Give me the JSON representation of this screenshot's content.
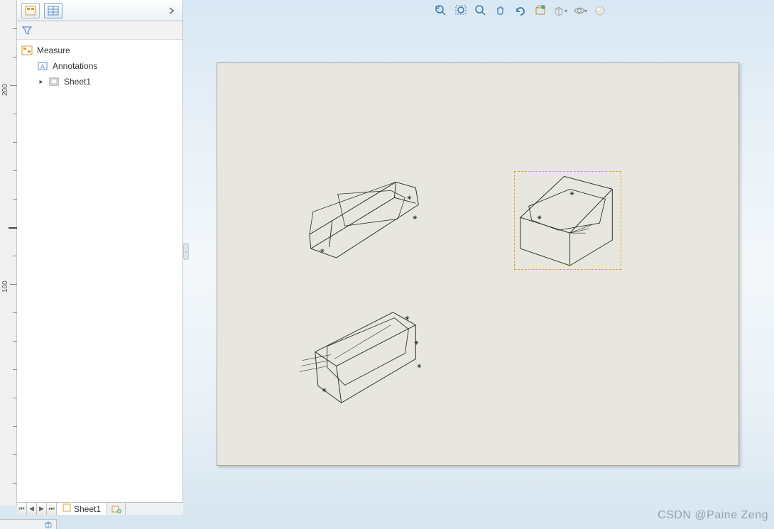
{
  "tree": {
    "root_label": "Measure",
    "annotations_label": "Annotations",
    "sheet_node_label": "Sheet1"
  },
  "sheet_tabs": {
    "active": "Sheet1"
  },
  "ruler": {
    "labels": [
      "200",
      "100"
    ]
  },
  "toolbar_icons": {
    "zoom_area": "zoom-to-area",
    "zoom_fit": "zoom-to-fit",
    "zoom_last": "zoom-previous",
    "pan": "pan",
    "redo": "redo",
    "section": "section-view",
    "display_style": "display-style",
    "hide_show": "hide-show",
    "appearance": "appearance"
  },
  "watermark_text": "CSDN @Paine Zeng"
}
